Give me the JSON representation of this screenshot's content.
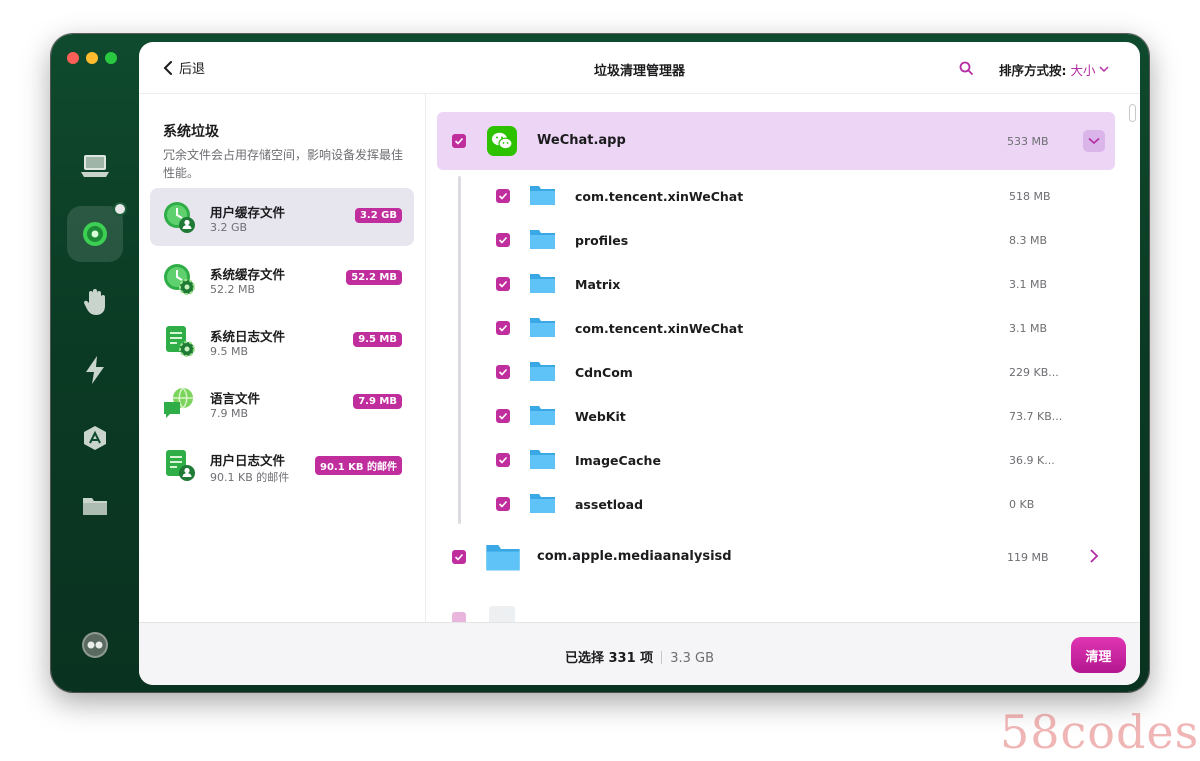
{
  "topbar": {
    "back_label": "后退",
    "title": "垃圾清理管理器",
    "sort_label": "排序方式按:",
    "sort_value": "大小"
  },
  "left": {
    "section_title": "系统垃圾",
    "section_desc": "冗余文件会占用存储空间，影响设备发挥最佳性能。",
    "categories": [
      {
        "name": "用户缓存文件",
        "sub": "3.2 GB",
        "badge": "3.2 GB"
      },
      {
        "name": "系统缓存文件",
        "sub": "52.2 MB",
        "badge": "52.2 MB"
      },
      {
        "name": "系统日志文件",
        "sub": "9.5 MB",
        "badge": "9.5 MB"
      },
      {
        "name": "语言文件",
        "sub": "7.9 MB",
        "badge": "7.9 MB"
      },
      {
        "name": "用户日志文件",
        "sub": "90.1 KB 的邮件",
        "badge": "90.1 KB 的邮件"
      }
    ]
  },
  "main": {
    "app": {
      "name": "WeChat.app",
      "size": "533 MB"
    },
    "children": [
      {
        "name": "com.tencent.xinWeChat",
        "size": "518 MB"
      },
      {
        "name": "profiles",
        "size": "8.3 MB"
      },
      {
        "name": "Matrix",
        "size": "3.1 MB"
      },
      {
        "name": "com.tencent.xinWeChat",
        "size": "3.1 MB"
      },
      {
        "name": "CdnCom",
        "size": "229 KB..."
      },
      {
        "name": "WebKit",
        "size": "73.7 KB..."
      },
      {
        "name": "ImageCache",
        "size": "36.9 K..."
      },
      {
        "name": "assetload",
        "size": "0 KB"
      }
    ],
    "next": {
      "name": "com.apple.mediaanalysisd",
      "size": "119 MB"
    }
  },
  "bottom": {
    "selected": "已选择 331 项",
    "total": "3.3 GB",
    "clean_label": "清理"
  },
  "watermark": "58codes",
  "colors": {
    "accent": "#c02e9e",
    "highlight_row": "#ecd5f5",
    "sidebar_bg": "#0b3b24"
  },
  "icons": {
    "rail": [
      "laptop-icon",
      "smart-scan-icon",
      "hand-icon",
      "lightning-icon",
      "apps-icon",
      "folder-icon",
      "assistant-icon"
    ],
    "categories": [
      "clock-user-icon",
      "clock-gear-icon",
      "doc-gear-icon",
      "globe-chat-icon",
      "doc-user-icon"
    ]
  }
}
